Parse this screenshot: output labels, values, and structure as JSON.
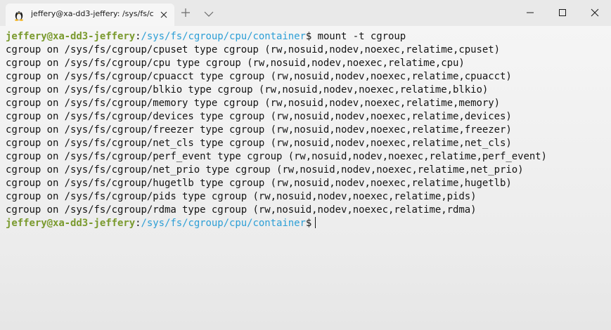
{
  "colors": {
    "prompt_user": "#7a9a2e",
    "prompt_path": "#2d9fd6",
    "text": "#141414",
    "titlebar": "#e9e9e9",
    "tab": "#f6f6f6"
  },
  "tab": {
    "icon": "linux-tux-icon",
    "title": "jeffery@xa-dd3-jeffery: /sys/fs/c"
  },
  "titlebar": {
    "new_tab_icon": "plus-icon",
    "dropdown_icon": "chevron-down-icon",
    "minimize_icon": "minimize-icon",
    "maximize_icon": "maximize-icon",
    "close_icon": "close-icon"
  },
  "terminal": {
    "prompt_user": "jeffery@xa-dd3-jeffery",
    "prompt_colon": ":",
    "prompt_path": "/sys/fs/cgroup/cpu/container",
    "prompt_dollar": "$",
    "command": " mount -t cgroup",
    "output": [
      "cgroup on /sys/fs/cgroup/cpuset type cgroup (rw,nosuid,nodev,noexec,relatime,cpuset)",
      "cgroup on /sys/fs/cgroup/cpu type cgroup (rw,nosuid,nodev,noexec,relatime,cpu)",
      "cgroup on /sys/fs/cgroup/cpuacct type cgroup (rw,nosuid,nodev,noexec,relatime,cpuacct)",
      "cgroup on /sys/fs/cgroup/blkio type cgroup (rw,nosuid,nodev,noexec,relatime,blkio)",
      "cgroup on /sys/fs/cgroup/memory type cgroup (rw,nosuid,nodev,noexec,relatime,memory)",
      "cgroup on /sys/fs/cgroup/devices type cgroup (rw,nosuid,nodev,noexec,relatime,devices)",
      "cgroup on /sys/fs/cgroup/freezer type cgroup (rw,nosuid,nodev,noexec,relatime,freezer)",
      "cgroup on /sys/fs/cgroup/net_cls type cgroup (rw,nosuid,nodev,noexec,relatime,net_cls)",
      "cgroup on /sys/fs/cgroup/perf_event type cgroup (rw,nosuid,nodev,noexec,relatime,perf_event)",
      "cgroup on /sys/fs/cgroup/net_prio type cgroup (rw,nosuid,nodev,noexec,relatime,net_prio)",
      "cgroup on /sys/fs/cgroup/hugetlb type cgroup (rw,nosuid,nodev,noexec,relatime,hugetlb)",
      "cgroup on /sys/fs/cgroup/pids type cgroup (rw,nosuid,nodev,noexec,relatime,pids)",
      "cgroup on /sys/fs/cgroup/rdma type cgroup (rw,nosuid,nodev,noexec,relatime,rdma)"
    ]
  }
}
